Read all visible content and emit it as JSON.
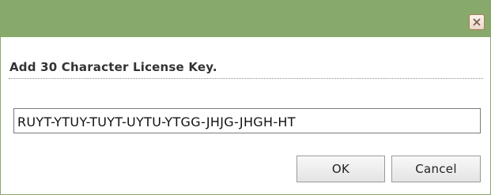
{
  "dialog": {
    "heading": "Add 30 Character License Key.",
    "license_key_value": "RUYT-YTUY-TUYT-UYTU-YTGG-JHJG-JHGH-HT",
    "ok_label": "OK",
    "cancel_label": "Cancel",
    "close_icon": "close-icon"
  },
  "colors": {
    "titlebar": "#87a96b",
    "close_border": "#b07b58",
    "close_glyph": "#7a5a46",
    "heading_text": "#333333"
  }
}
